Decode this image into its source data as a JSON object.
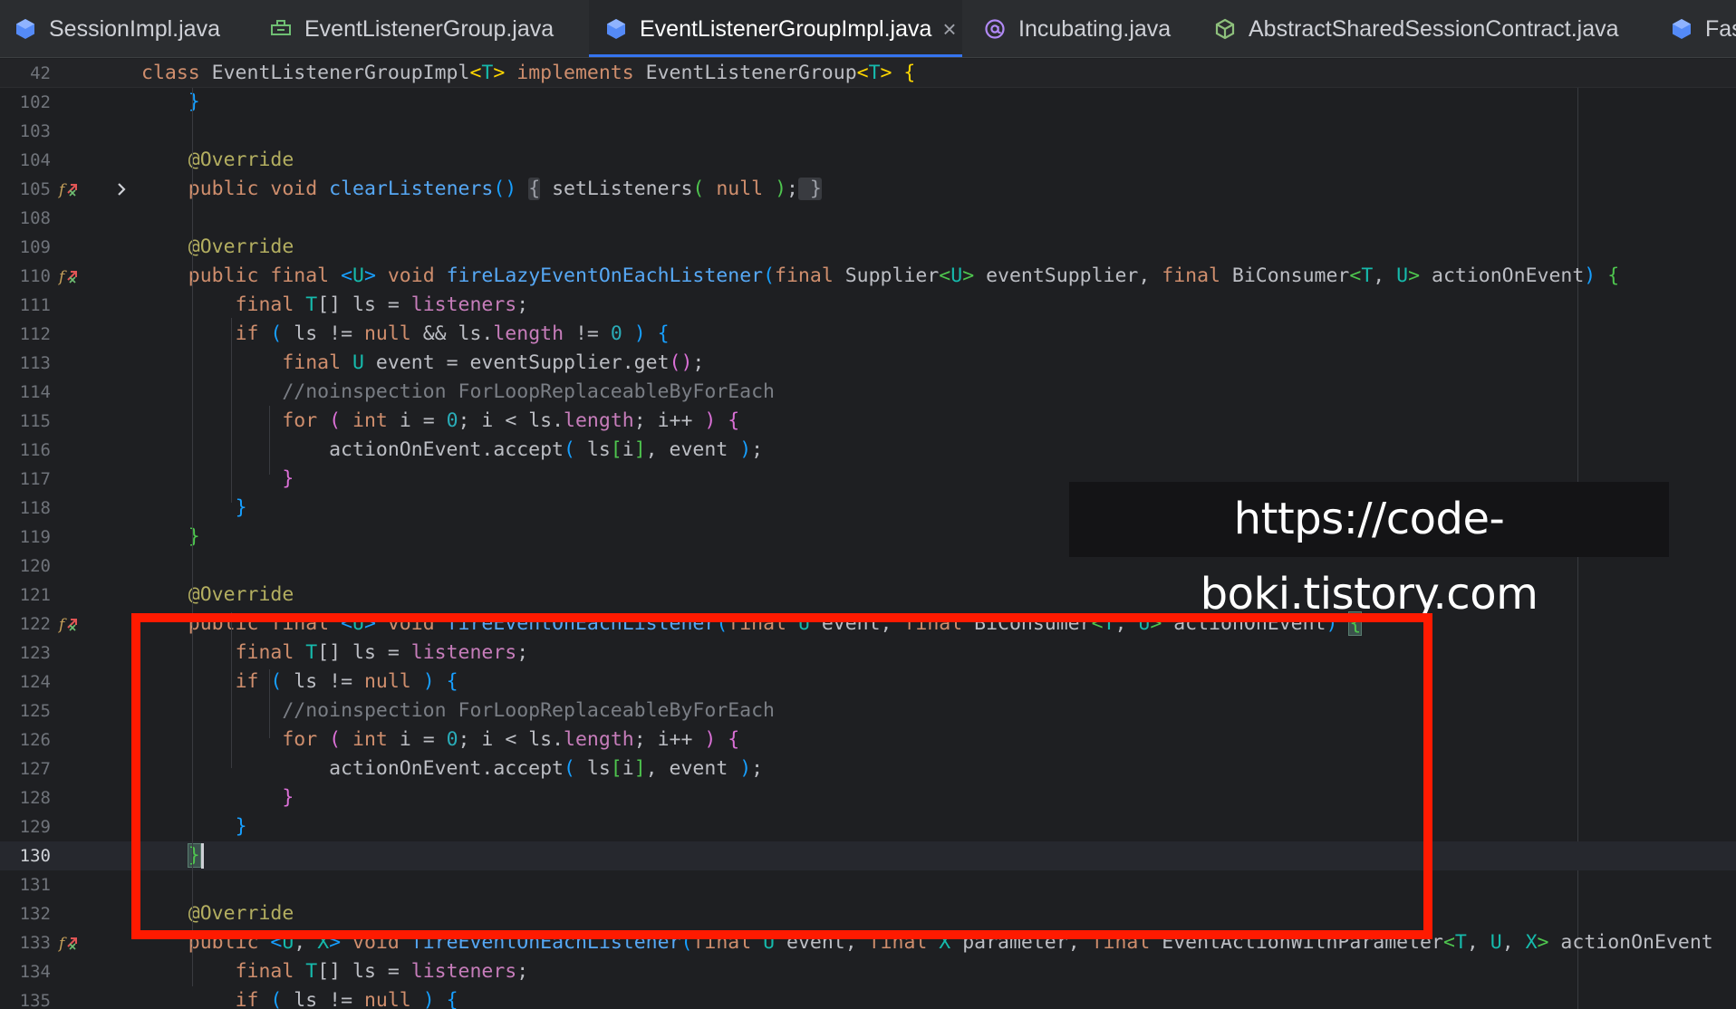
{
  "tabs": [
    {
      "label": "SessionImpl.java",
      "icon": "class-icon",
      "active": false
    },
    {
      "label": "EventListenerGroup.java",
      "icon": "interface-icon",
      "active": false
    },
    {
      "label": "EventListenerGroupImpl.java",
      "icon": "class-icon",
      "active": true
    },
    {
      "label": "Incubating.java",
      "icon": "annotation-icon",
      "active": false
    },
    {
      "label": "AbstractSharedSessionContract.java",
      "icon": "abstract-class-icon",
      "active": false
    },
    {
      "label": "Fas",
      "icon": "class-icon",
      "active": false
    }
  ],
  "tab_close_glyph": "×",
  "watermark": "https://code-boki.tistory.com",
  "colors": {
    "accent": "#3574f0",
    "highlight_box": "#ff1a00",
    "background": "#1e1f22"
  },
  "editor": {
    "current_line": "130",
    "lines": [
      {
        "num": "42",
        "sticky": true,
        "segments": [
          {
            "t": "class ",
            "c": "kw"
          },
          {
            "t": "EventListenerGroupImpl"
          },
          {
            "t": "<",
            "c": "p1"
          },
          {
            "t": "T",
            "c": "tp"
          },
          {
            "t": "> ",
            "c": "p1"
          },
          {
            "t": "implements ",
            "c": "kw"
          },
          {
            "t": "EventListenerGroup"
          },
          {
            "t": "<",
            "c": "p1"
          },
          {
            "t": "T",
            "c": "tp"
          },
          {
            "t": "> {",
            "c": "p1"
          }
        ]
      },
      {
        "num": "102",
        "segments": [
          {
            "t": "    }",
            "c": "p3"
          }
        ]
      },
      {
        "num": "103",
        "segments": []
      },
      {
        "num": "104",
        "segments": [
          {
            "t": "    "
          },
          {
            "t": "@Override",
            "c": "ann"
          }
        ]
      },
      {
        "num": "105",
        "gutter": "override-icon",
        "fold": "chevron-right-icon",
        "segments": [
          {
            "t": "    "
          },
          {
            "t": "public void ",
            "c": "kw"
          },
          {
            "t": "clearListeners",
            "c": "fn"
          },
          {
            "t": "()",
            "c": "p3"
          },
          {
            "t": " ",
            "c": "sp"
          },
          {
            "t": "{",
            "c": "fbox"
          },
          {
            "t": " setListeners"
          },
          {
            "t": "(",
            "c": "p4"
          },
          {
            "t": " "
          },
          {
            "t": "null",
            "c": "kw"
          },
          {
            "t": " "
          },
          {
            "t": ")",
            "c": "p4"
          },
          {
            "t": ";"
          },
          {
            "t": " }",
            "c": "fbox"
          }
        ]
      },
      {
        "num": "108",
        "segments": []
      },
      {
        "num": "109",
        "segments": [
          {
            "t": "    "
          },
          {
            "t": "@Override",
            "c": "ann"
          }
        ]
      },
      {
        "num": "110",
        "gutter": "override-icon",
        "segments": [
          {
            "t": "    "
          },
          {
            "t": "public final ",
            "c": "kw"
          },
          {
            "t": "<",
            "c": "p3"
          },
          {
            "t": "U",
            "c": "tp"
          },
          {
            "t": "> ",
            "c": "p3"
          },
          {
            "t": "void ",
            "c": "kw"
          },
          {
            "t": "fireLazyEventOnEachListener",
            "c": "fn"
          },
          {
            "t": "(",
            "c": "p3"
          },
          {
            "t": "final ",
            "c": "kw"
          },
          {
            "t": "Supplier"
          },
          {
            "t": "<",
            "c": "p4"
          },
          {
            "t": "U",
            "c": "tp"
          },
          {
            "t": ">",
            "c": "p4"
          },
          {
            "t": " eventSupplier, "
          },
          {
            "t": "final ",
            "c": "kw"
          },
          {
            "t": "BiConsumer"
          },
          {
            "t": "<",
            "c": "p4"
          },
          {
            "t": "T",
            "c": "tp"
          },
          {
            "t": ", "
          },
          {
            "t": "U",
            "c": "tp"
          },
          {
            "t": ">",
            "c": "p4"
          },
          {
            "t": " actionOnEvent"
          },
          {
            "t": ")",
            "c": "p3"
          },
          {
            "t": " "
          },
          {
            "t": "{",
            "c": "p4"
          }
        ]
      },
      {
        "num": "111",
        "segments": [
          {
            "t": "        "
          },
          {
            "t": "final ",
            "c": "kw"
          },
          {
            "t": "T",
            "c": "tp"
          },
          {
            "t": "[] ls = "
          },
          {
            "t": "listeners",
            "c": "fld"
          },
          {
            "t": ";"
          }
        ]
      },
      {
        "num": "112",
        "segments": [
          {
            "t": "        "
          },
          {
            "t": "if ",
            "c": "kw"
          },
          {
            "t": "(",
            "c": "p3"
          },
          {
            "t": " ls != "
          },
          {
            "t": "null",
            "c": "kw"
          },
          {
            "t": " && ls."
          },
          {
            "t": "length",
            "c": "fld"
          },
          {
            "t": " != "
          },
          {
            "t": "0",
            "c": "num"
          },
          {
            "t": " "
          },
          {
            "t": ")",
            "c": "p3"
          },
          {
            "t": " "
          },
          {
            "t": "{",
            "c": "p3"
          }
        ]
      },
      {
        "num": "113",
        "segments": [
          {
            "t": "            "
          },
          {
            "t": "final ",
            "c": "kw"
          },
          {
            "t": "U",
            "c": "tp"
          },
          {
            "t": " event = eventSupplier.get"
          },
          {
            "t": "()",
            "c": "p2"
          },
          {
            "t": ";"
          }
        ]
      },
      {
        "num": "114",
        "segments": [
          {
            "t": "            "
          },
          {
            "t": "//noinspection ForLoopReplaceableByForEach",
            "c": "cm"
          }
        ]
      },
      {
        "num": "115",
        "segments": [
          {
            "t": "            "
          },
          {
            "t": "for ",
            "c": "kw"
          },
          {
            "t": "(",
            "c": "p2"
          },
          {
            "t": " "
          },
          {
            "t": "int ",
            "c": "kw"
          },
          {
            "t": "i = "
          },
          {
            "t": "0",
            "c": "num"
          },
          {
            "t": "; i < ls."
          },
          {
            "t": "length",
            "c": "fld"
          },
          {
            "t": "; i++ "
          },
          {
            "t": ")",
            "c": "p2"
          },
          {
            "t": " "
          },
          {
            "t": "{",
            "c": "p2"
          }
        ]
      },
      {
        "num": "116",
        "segments": [
          {
            "t": "                actionOnEvent.accept"
          },
          {
            "t": "(",
            "c": "p3"
          },
          {
            "t": " ls"
          },
          {
            "t": "[",
            "c": "p4"
          },
          {
            "t": "i"
          },
          {
            "t": "]",
            "c": "p4"
          },
          {
            "t": ", event "
          },
          {
            "t": ")",
            "c": "p3"
          },
          {
            "t": ";"
          }
        ]
      },
      {
        "num": "117",
        "segments": [
          {
            "t": "            "
          },
          {
            "t": "}",
            "c": "p2"
          }
        ]
      },
      {
        "num": "118",
        "segments": [
          {
            "t": "        "
          },
          {
            "t": "}",
            "c": "p3"
          }
        ]
      },
      {
        "num": "119",
        "segments": [
          {
            "t": "    "
          },
          {
            "t": "}",
            "c": "p4"
          }
        ]
      },
      {
        "num": "120",
        "segments": []
      },
      {
        "num": "121",
        "segments": [
          {
            "t": "    "
          },
          {
            "t": "@Override",
            "c": "ann"
          }
        ]
      },
      {
        "num": "122",
        "gutter": "override-icon",
        "segments": [
          {
            "t": "    "
          },
          {
            "t": "public final ",
            "c": "kw"
          },
          {
            "t": "<",
            "c": "p3"
          },
          {
            "t": "U",
            "c": "tp"
          },
          {
            "t": "> ",
            "c": "p3"
          },
          {
            "t": "void ",
            "c": "kw"
          },
          {
            "t": "fireEventOnEachListener",
            "c": "fn"
          },
          {
            "t": "(",
            "c": "p3"
          },
          {
            "t": "final ",
            "c": "kw"
          },
          {
            "t": "U",
            "c": "tp"
          },
          {
            "t": " event, "
          },
          {
            "t": "final ",
            "c": "kw"
          },
          {
            "t": "BiConsumer"
          },
          {
            "t": "<",
            "c": "p4"
          },
          {
            "t": "T",
            "c": "tp"
          },
          {
            "t": ", "
          },
          {
            "t": "U",
            "c": "tp"
          },
          {
            "t": ">",
            "c": "p4"
          },
          {
            "t": " actionOnEvent"
          },
          {
            "t": ")",
            "c": "p3"
          },
          {
            "t": " "
          },
          {
            "t": "{",
            "c": "bmatch p4"
          }
        ]
      },
      {
        "num": "123",
        "segments": [
          {
            "t": "        "
          },
          {
            "t": "final ",
            "c": "kw"
          },
          {
            "t": "T",
            "c": "tp"
          },
          {
            "t": "[] ls = "
          },
          {
            "t": "listeners",
            "c": "fld"
          },
          {
            "t": ";"
          }
        ]
      },
      {
        "num": "124",
        "segments": [
          {
            "t": "        "
          },
          {
            "t": "if ",
            "c": "kw"
          },
          {
            "t": "(",
            "c": "p3"
          },
          {
            "t": " ls != "
          },
          {
            "t": "null",
            "c": "kw"
          },
          {
            "t": " "
          },
          {
            "t": ")",
            "c": "p3"
          },
          {
            "t": " "
          },
          {
            "t": "{",
            "c": "p3"
          }
        ]
      },
      {
        "num": "125",
        "segments": [
          {
            "t": "            "
          },
          {
            "t": "//noinspection ForLoopReplaceableByForEach",
            "c": "cm"
          }
        ]
      },
      {
        "num": "126",
        "segments": [
          {
            "t": "            "
          },
          {
            "t": "for ",
            "c": "kw"
          },
          {
            "t": "(",
            "c": "p2"
          },
          {
            "t": " "
          },
          {
            "t": "int ",
            "c": "kw"
          },
          {
            "t": "i = "
          },
          {
            "t": "0",
            "c": "num"
          },
          {
            "t": "; i < ls."
          },
          {
            "t": "length",
            "c": "fld"
          },
          {
            "t": "; i++ "
          },
          {
            "t": ")",
            "c": "p2"
          },
          {
            "t": " "
          },
          {
            "t": "{",
            "c": "p2"
          }
        ]
      },
      {
        "num": "127",
        "segments": [
          {
            "t": "                actionOnEvent.accept"
          },
          {
            "t": "(",
            "c": "p3"
          },
          {
            "t": " ls"
          },
          {
            "t": "[",
            "c": "p4"
          },
          {
            "t": "i"
          },
          {
            "t": "]",
            "c": "p4"
          },
          {
            "t": ", event "
          },
          {
            "t": ")",
            "c": "p3"
          },
          {
            "t": ";"
          }
        ]
      },
      {
        "num": "128",
        "segments": [
          {
            "t": "            "
          },
          {
            "t": "}",
            "c": "p2"
          }
        ]
      },
      {
        "num": "129",
        "segments": [
          {
            "t": "        "
          },
          {
            "t": "}",
            "c": "p3"
          }
        ]
      },
      {
        "num": "130",
        "caret": true,
        "segments": [
          {
            "t": "    "
          },
          {
            "t": "}",
            "c": "bmatch p4"
          }
        ]
      },
      {
        "num": "131",
        "segments": []
      },
      {
        "num": "132",
        "segments": [
          {
            "t": "    "
          },
          {
            "t": "@Override",
            "c": "ann"
          }
        ]
      },
      {
        "num": "133",
        "gutter": "override-icon",
        "segments": [
          {
            "t": "    "
          },
          {
            "t": "public ",
            "c": "kw"
          },
          {
            "t": "<",
            "c": "p3"
          },
          {
            "t": "U",
            "c": "tp"
          },
          {
            "t": ", "
          },
          {
            "t": "X",
            "c": "tp"
          },
          {
            "t": "> ",
            "c": "p3"
          },
          {
            "t": "void ",
            "c": "kw"
          },
          {
            "t": "fireEventOnEachListener",
            "c": "fn"
          },
          {
            "t": "(",
            "c": "p3"
          },
          {
            "t": "final ",
            "c": "kw"
          },
          {
            "t": "U",
            "c": "tp"
          },
          {
            "t": " event, "
          },
          {
            "t": "final ",
            "c": "kw"
          },
          {
            "t": "X",
            "c": "tp"
          },
          {
            "t": " parameter, "
          },
          {
            "t": "final ",
            "c": "kw"
          },
          {
            "t": "EventActionWithParameter"
          },
          {
            "t": "<",
            "c": "p4"
          },
          {
            "t": "T",
            "c": "tp"
          },
          {
            "t": ", "
          },
          {
            "t": "U",
            "c": "tp"
          },
          {
            "t": ", "
          },
          {
            "t": "X",
            "c": "tp"
          },
          {
            "t": ">",
            "c": "p4"
          },
          {
            "t": " actionOnEvent"
          }
        ]
      },
      {
        "num": "134",
        "segments": [
          {
            "t": "        "
          },
          {
            "t": "final ",
            "c": "kw"
          },
          {
            "t": "T",
            "c": "tp"
          },
          {
            "t": "[] ls = "
          },
          {
            "t": "listeners",
            "c": "fld"
          },
          {
            "t": ";"
          }
        ]
      },
      {
        "num": "135",
        "segments": [
          {
            "t": "        "
          },
          {
            "t": "if ",
            "c": "kw"
          },
          {
            "t": "(",
            "c": "p3"
          },
          {
            "t": " ls != "
          },
          {
            "t": "null",
            "c": "kw"
          },
          {
            "t": " "
          },
          {
            "t": ")",
            "c": "p3"
          },
          {
            "t": " "
          },
          {
            "t": "{",
            "c": "p3"
          }
        ]
      }
    ]
  }
}
